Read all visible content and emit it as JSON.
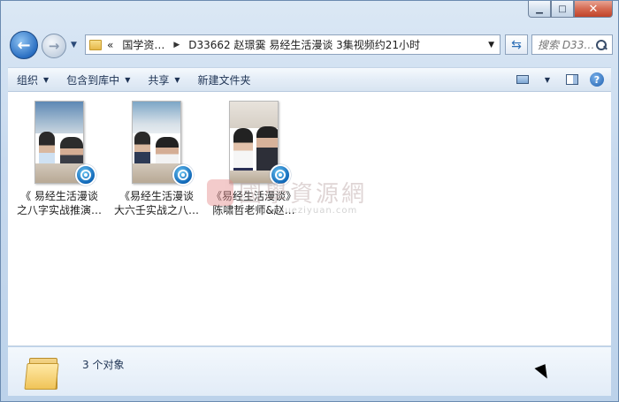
{
  "caption": {
    "minimize": "▁",
    "maximize": "□",
    "close": "✕"
  },
  "nav": {
    "back": "←",
    "forward": "→",
    "dropdown": "▼",
    "breadcrumb_prefix": "«",
    "crumbs": [
      "国学资…",
      "D33662 赵璟霙 易经生活漫谈 3集视频约21小时"
    ],
    "separator": "▶",
    "address_dropdown": "▼",
    "refresh": "⇆"
  },
  "search": {
    "placeholder": "搜索 D33…"
  },
  "toolbar": {
    "organize": "组织",
    "include_in_library": "包含到库中",
    "share": "共享",
    "new_folder": "新建文件夹",
    "caret": "▼",
    "help": "?"
  },
  "files": [
    {
      "line1": "《 易经生活漫谈",
      "line2": "之八字实战推演…"
    },
    {
      "line1": "《易经生活漫谈",
      "line2": "大六壬实战之八…"
    },
    {
      "line1": "《易经生活漫谈》",
      "line2": "陈啸哲老师&赵…"
    }
  ],
  "watermark": {
    "title": "國學資源網",
    "url": "guoxueziyuan.com"
  },
  "details": {
    "count": "3 个对象"
  }
}
